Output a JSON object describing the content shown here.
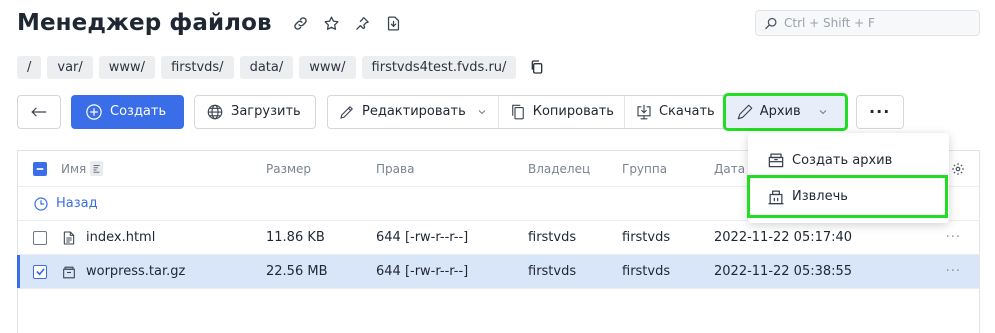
{
  "header": {
    "title": "Менеджер файлов",
    "icons": [
      "link-icon",
      "star-icon",
      "pin-icon",
      "download-page-icon"
    ]
  },
  "search": {
    "placeholder": "Ctrl + Shift + F"
  },
  "breadcrumb": {
    "items": [
      "/",
      "var/",
      "www/",
      "firstvds/",
      "data/",
      "www/",
      "firstvds4test.fvds.ru/"
    ],
    "copy_icon": "copy-icon"
  },
  "toolbar": {
    "create_label": "Создать",
    "upload_label": "Загрузить",
    "edit_label": "Редактировать",
    "copy_label": "Копировать",
    "download_label": "Скачать",
    "archive_label": "Архив",
    "more_label": "···"
  },
  "archive_menu": {
    "items": [
      "Создать архив",
      "Извлечь"
    ]
  },
  "table": {
    "columns": {
      "name": "Имя",
      "size": "Размер",
      "perm": "Права",
      "owner": "Владелец",
      "group": "Группа",
      "date": "Дата и"
    },
    "back_label": "Назад",
    "rows": [
      {
        "name": "index.html",
        "size": "11.86 KB",
        "perm": "644 [-rw-r--r--]",
        "owner": "firstvds",
        "group": "firstvds",
        "date": "2022-11-22 05:17:40",
        "selected": false,
        "icon": "html-file-icon"
      },
      {
        "name": "worpress.tar.gz",
        "size": "22.56 MB",
        "perm": "644 [-rw-r--r--]",
        "owner": "firstvds",
        "group": "firstvds",
        "date": "2022-11-22 05:38:55",
        "selected": true,
        "icon": "archive-file-icon"
      }
    ],
    "row_actions": "···"
  },
  "colors": {
    "accent": "#3a6ee8",
    "highlight": "#22dd22",
    "selected_row": "#d9e5f8"
  }
}
